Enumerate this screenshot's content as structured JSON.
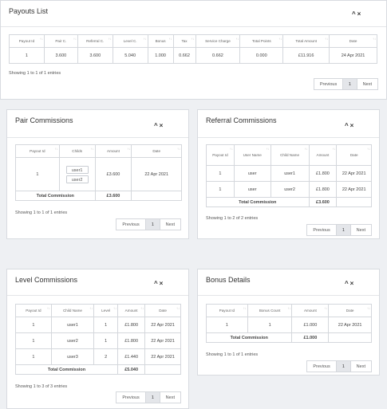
{
  "payouts": {
    "title": "Payouts List",
    "headers": [
      "Payout Id",
      "Pair C.",
      "Referral C.",
      "Level C.",
      "Bonus",
      "Tax",
      "Service Charge",
      "Total Points",
      "Total Amount",
      "Date"
    ],
    "row": [
      "1",
      "3.600",
      "3.600",
      "5.040",
      "1.000",
      "0.662",
      "0.662",
      "0.000",
      "£11.916",
      "24 Apr 2021"
    ],
    "showing": "Showing 1 to 1 of 1 entries"
  },
  "pair": {
    "title": "Pair Commissions",
    "headers": [
      "Payout Id",
      "Childs",
      "Amount",
      "Date"
    ],
    "payout_id": "1",
    "children": [
      "user1",
      "user2"
    ],
    "amount": "£3.600",
    "date": "22 Apr 2021",
    "total_label": "Total Commission",
    "total": "£3.600",
    "showing": "Showing 1 to 1 of 1 entries"
  },
  "referral": {
    "title": "Referral Commissions",
    "headers": [
      "Payout Id",
      "User Name",
      "Child Name",
      "Amount",
      "Date"
    ],
    "rows": [
      [
        "1",
        "user",
        "user1",
        "£1.800",
        "22 Apr 2021"
      ],
      [
        "1",
        "user",
        "user2",
        "£1.800",
        "22 Apr 2021"
      ]
    ],
    "total_label": "Total Commission",
    "total": "£3.600",
    "showing": "Showing 1 to 2 of 2 entries"
  },
  "level": {
    "title": "Level Commissions",
    "headers": [
      "Payout Id",
      "Child Name",
      "Level",
      "Amount",
      "Date"
    ],
    "rows": [
      [
        "1",
        "user1",
        "1",
        "£1.800",
        "22 Apr 2021"
      ],
      [
        "1",
        "user2",
        "1",
        "£1.800",
        "22 Apr 2021"
      ],
      [
        "1",
        "user3",
        "2",
        "£1.440",
        "22 Apr 2021"
      ]
    ],
    "total_label": "Total Commission",
    "total": "£5.040",
    "showing": "Showing 1 to 3 of 3 entries"
  },
  "bonus": {
    "title": "Bonus Details",
    "headers": [
      "Payout Id",
      "Bonus Count",
      "Amount",
      "Date"
    ],
    "row": [
      "1",
      "1",
      "£1.000",
      "22 Apr 2021"
    ],
    "total_label": "Total Commission",
    "total": "£1.000",
    "showing": "Showing 1 to 1 of 1 entries"
  },
  "pager": {
    "previous": "Previous",
    "page": "1",
    "next": "Next"
  },
  "controls": {
    "collapse": "^",
    "close": "×"
  },
  "sort_icon": "↑↓"
}
